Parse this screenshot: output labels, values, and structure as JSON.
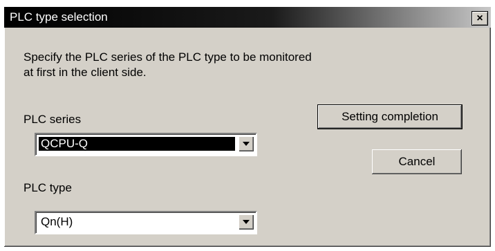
{
  "window": {
    "title": "PLC type selection",
    "close_label": "×"
  },
  "instructions": "Specify the PLC series of the PLC type  to be monitored\n at first in the client side.",
  "plc_series": {
    "label": "PLC series",
    "selected_value": "QCPU-Q"
  },
  "plc_type": {
    "label": "PLC type",
    "selected_value": "Qn(H)"
  },
  "buttons": {
    "setting_completion": "Setting completion",
    "cancel": "Cancel"
  }
}
